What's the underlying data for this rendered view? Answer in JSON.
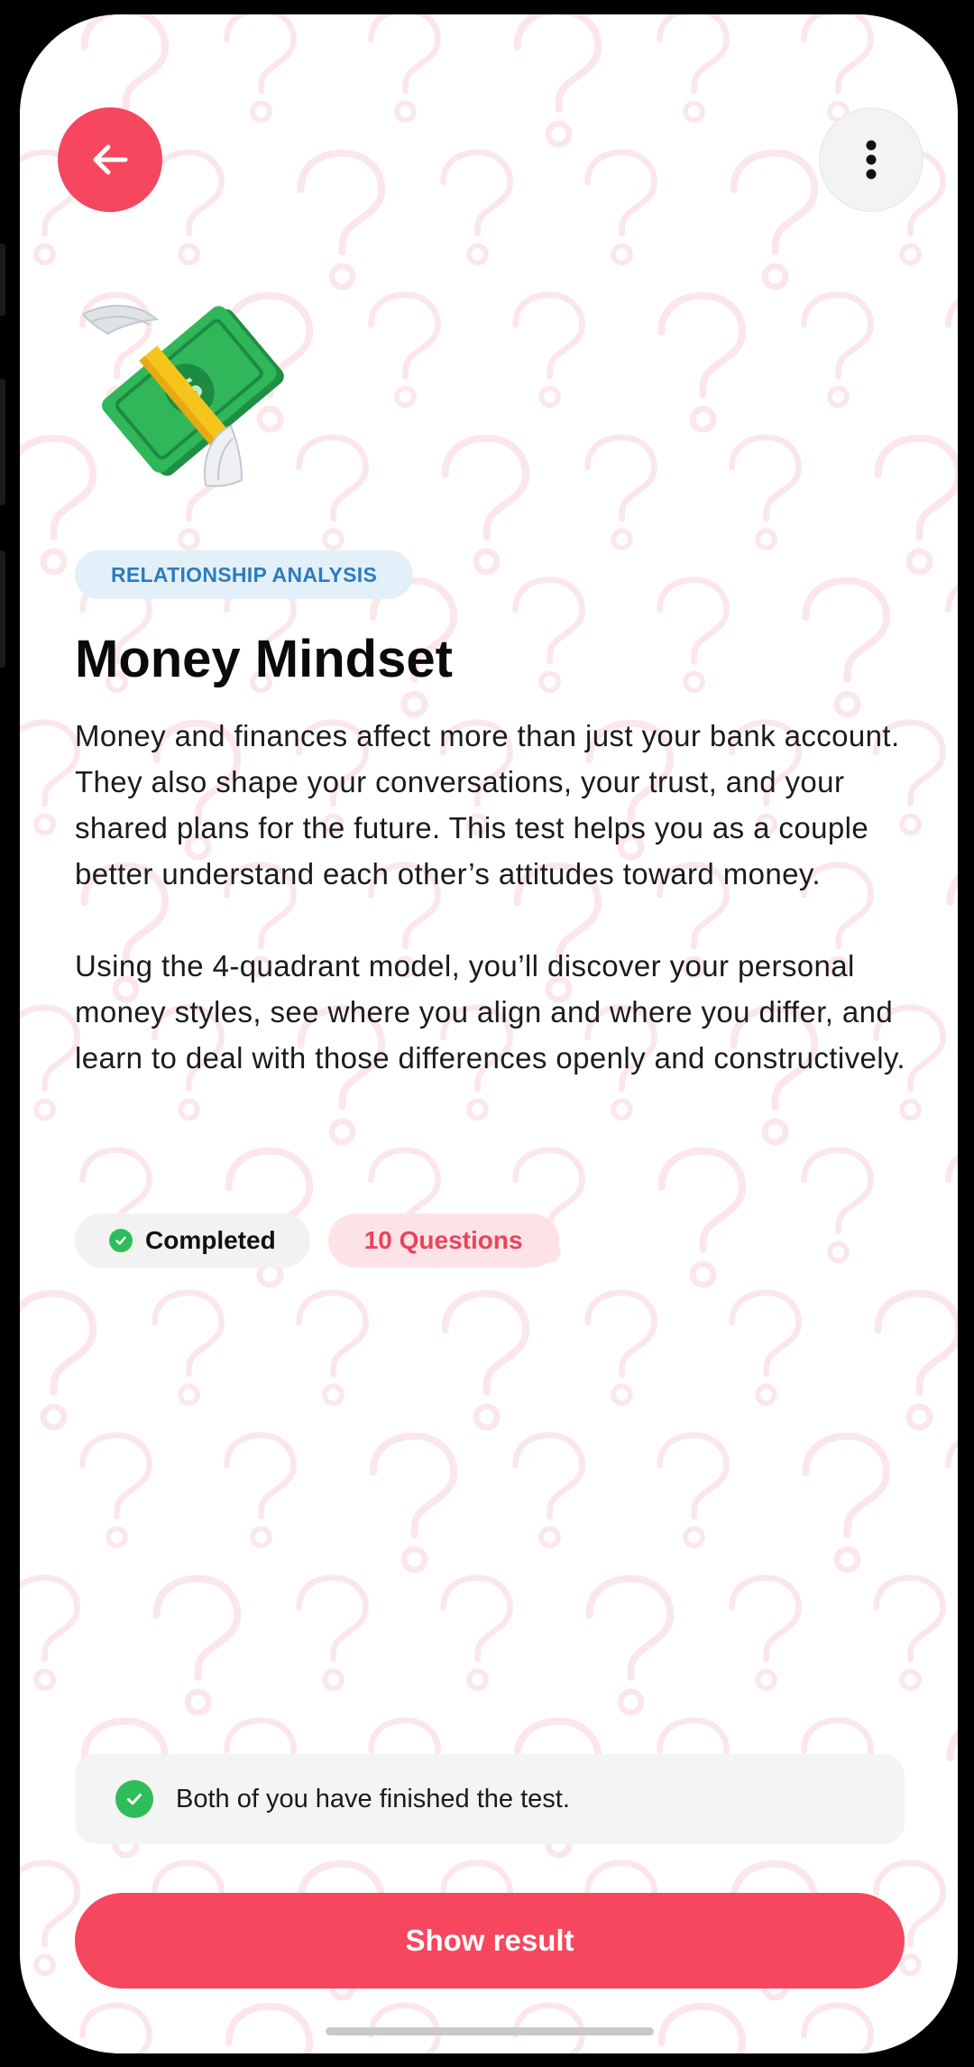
{
  "header": {
    "back_icon": "arrow-left-icon",
    "more_icon": "more-vertical-icon"
  },
  "hero": {
    "icon": "money-with-wings-icon"
  },
  "test": {
    "category": "RELATIONSHIP ANALYSIS",
    "title": "Money Mindset",
    "description_1": "Money and finances affect more than just your bank account. They also shape your conversations, your trust, and your shared plans for the future. This test helps you as a couple better understand each other’s attitudes toward money.",
    "description_2": "Using the 4-quadrant model, you’ll discover your personal money styles, see where you align and where you differ, and learn to deal with those differences openly and constructively."
  },
  "status": {
    "completed_label": "Completed",
    "questions_label": "10 Questions"
  },
  "notice": {
    "text": "Both of you have finished the test."
  },
  "cta": {
    "label": "Show result"
  },
  "colors": {
    "accent": "#f6475f",
    "success": "#2ebd59",
    "category_text": "#2d7bbf",
    "category_bg": "#e3f0fa",
    "pattern": "#fbe7ea"
  }
}
